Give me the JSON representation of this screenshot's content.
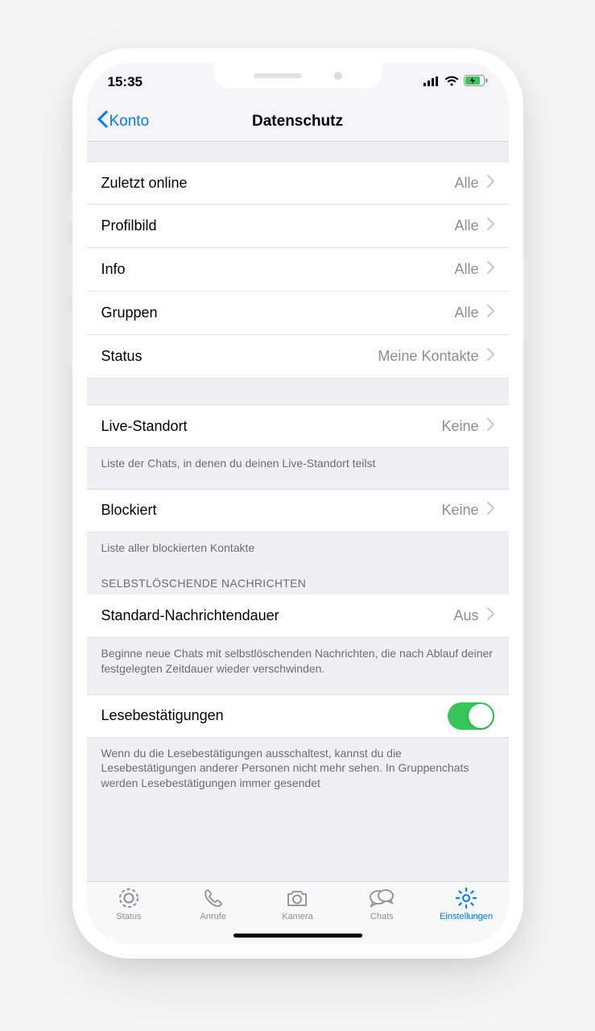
{
  "statusbar": {
    "time": "15:35"
  },
  "header": {
    "back": "Konto",
    "title": "Datenschutz"
  },
  "rows": {
    "last_seen": {
      "label": "Zuletzt online",
      "value": "Alle"
    },
    "profile_pic": {
      "label": "Profilbild",
      "value": "Alle"
    },
    "info": {
      "label": "Info",
      "value": "Alle"
    },
    "groups": {
      "label": "Gruppen",
      "value": "Alle"
    },
    "status": {
      "label": "Status",
      "value": "Meine Kontakte"
    },
    "live_loc": {
      "label": "Live-Standort",
      "value": "Keine"
    },
    "blocked": {
      "label": "Blockiert",
      "value": "Keine"
    },
    "msg_timer": {
      "label": "Standard-Nachrichtendauer",
      "value": "Aus"
    },
    "read_rec": {
      "label": "Lesebestätigungen",
      "on": true
    }
  },
  "footers": {
    "live_loc": "Liste der Chats, in denen du deinen Live-Standort teilst",
    "blocked": "Liste aller blockierten Kontakte",
    "msg_timer": "Beginne neue Chats mit selbstlöschenden Nachrichten, die nach Ablauf deiner festgelegten Zeitdauer wieder verschwinden.",
    "read_rec": "Wenn du die Lesebestätigungen ausschaltest, kannst du die Lesebestätigungen anderer Personen nicht mehr sehen. In Gruppenchats werden Lesebestätigungen immer gesendet"
  },
  "section_headers": {
    "disappearing": "SELBSTLÖSCHENDE NACHRICHTEN"
  },
  "tabs": {
    "status": "Status",
    "calls": "Anrufe",
    "camera": "Kamera",
    "chats": "Chats",
    "settings": "Einstellungen"
  }
}
